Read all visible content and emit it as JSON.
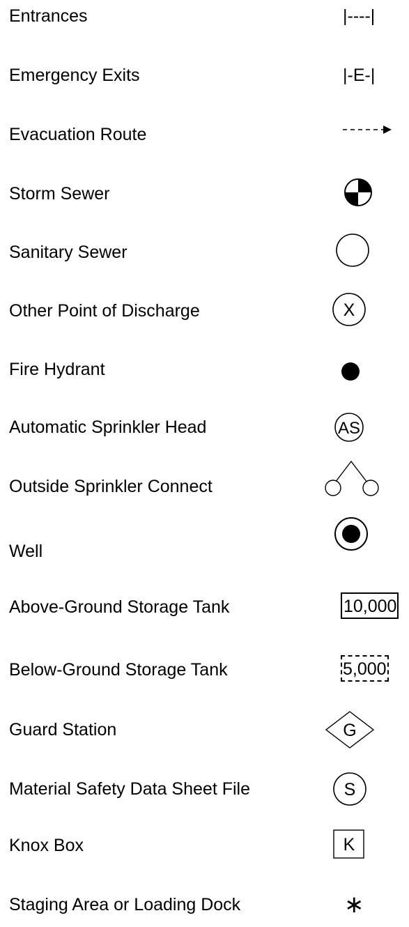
{
  "legend": {
    "entrances": {
      "label": "Entrances",
      "symbol": "|----|"
    },
    "emergency_exits": {
      "label": "Emergency Exits",
      "symbol": "|-E-|"
    },
    "evacuation_route": {
      "label": "Evacuation Route",
      "icon": "dashed-arrow-icon"
    },
    "storm_sewer": {
      "label": "Storm Sewer",
      "icon": "quartered-circle-icon"
    },
    "sanitary_sewer": {
      "label": "Sanitary Sewer",
      "icon": "empty-circle-icon"
    },
    "other_discharge": {
      "label": "Other Point of Discharge",
      "symbol": "X"
    },
    "fire_hydrant": {
      "label": "Fire Hydrant",
      "icon": "filled-dot-icon"
    },
    "sprinkler_head": {
      "label": "Automatic Sprinkler Head",
      "symbol": "AS"
    },
    "outside_sprinkler": {
      "label": "Outside Sprinkler Connect",
      "icon": "sprinkler-connect-icon"
    },
    "well": {
      "label": "Well",
      "icon": "ring-dot-icon"
    },
    "above_tank": {
      "label": "Above-Ground Storage Tank",
      "symbol": "10,000"
    },
    "below_tank": {
      "label": "Below-Ground Storage Tank",
      "symbol": "5,000"
    },
    "guard_station": {
      "label": "Guard Station",
      "symbol": "G"
    },
    "msds_file": {
      "label": "Material Safety Data Sheet File",
      "symbol": "S"
    },
    "knox_box": {
      "label": "Knox Box",
      "symbol": "K"
    },
    "staging_area": {
      "label": "Staging Area or Loading Dock",
      "symbol": "∗"
    }
  }
}
